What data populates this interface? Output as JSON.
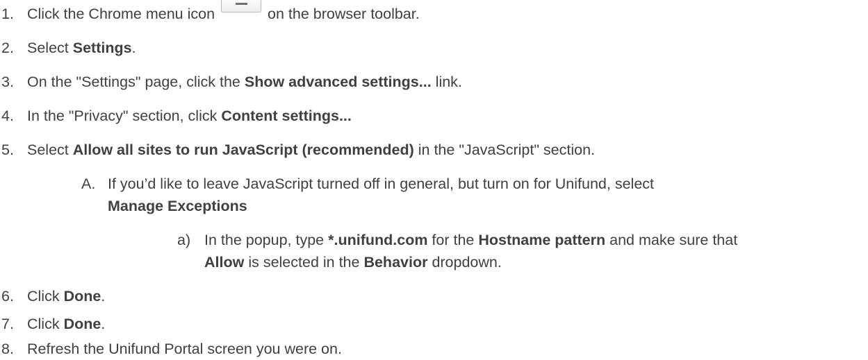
{
  "steps": [
    {
      "num": "1.",
      "parts": [
        "Click the Chrome menu icon",
        "on the browser toolbar."
      ],
      "icon": "chrome-menu-icon"
    },
    {
      "num": "2.",
      "parts": [
        "Select ",
        "Settings",
        "."
      ]
    },
    {
      "num": "3.",
      "parts": [
        "On the \"Settings\" page, click the ",
        "Show advanced settings...",
        " link."
      ]
    },
    {
      "num": "4.",
      "parts": [
        "In the \"Privacy\" section, click ",
        "Content settings..."
      ]
    },
    {
      "num": "5.",
      "parts": [
        "Select ",
        "Allow all sites to run JavaScript (recommended)",
        " in the \"JavaScript\" section."
      ]
    },
    {
      "num": "A.",
      "parts": [
        "If you’d like to leave JavaScript turned off in general, but turn on for Unifund, select",
        "Manage Exceptions"
      ]
    },
    {
      "num": "a)",
      "parts": [
        "In the popup, type ",
        "*.unifund.com",
        " for the ",
        "Hostname pattern",
        " and make sure that",
        "Allow",
        " is selected in the ",
        "Behavior",
        " dropdown."
      ]
    },
    {
      "num": "6.",
      "parts": [
        "Click ",
        "Done",
        "."
      ]
    },
    {
      "num": "7.",
      "parts": [
        "Click ",
        "Done",
        "."
      ]
    },
    {
      "num": "8.",
      "parts": [
        "Refresh the Unifund Portal screen you were on."
      ]
    }
  ]
}
